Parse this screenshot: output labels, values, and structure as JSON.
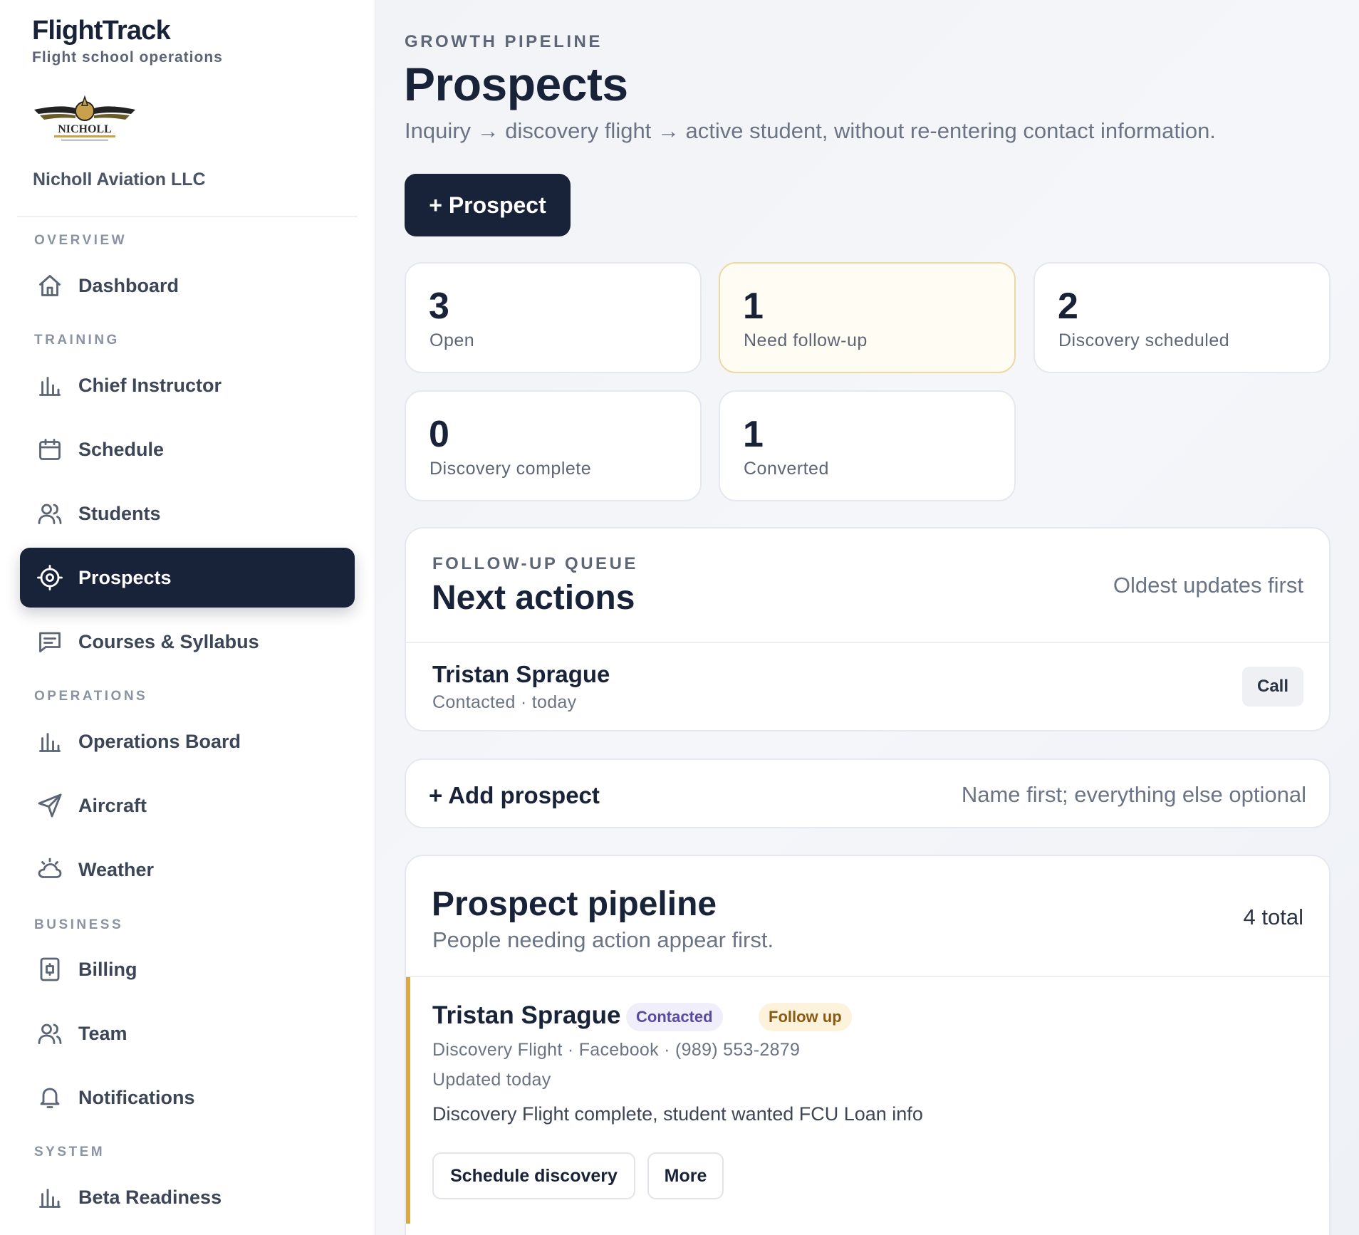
{
  "brand": {
    "name": "FlightTrack",
    "tagline": "Flight school operations",
    "org_name": "Nicholl Aviation LLC",
    "logo_text": "NICHOLL"
  },
  "sidebar": {
    "sections": {
      "overview": "OVERVIEW",
      "training": "TRAINING",
      "operations": "OPERATIONS",
      "business": "BUSINESS",
      "system": "SYSTEM"
    },
    "items": {
      "dashboard": "Dashboard",
      "chief_instructor": "Chief Instructor",
      "schedule": "Schedule",
      "students": "Students",
      "prospects": "Prospects",
      "courses": "Courses & Syllabus",
      "operations_board": "Operations Board",
      "aircraft": "Aircraft",
      "weather": "Weather",
      "billing": "Billing",
      "team": "Team",
      "notifications": "Notifications",
      "beta_readiness": "Beta Readiness"
    },
    "active": "prospects"
  },
  "header": {
    "eyebrow": "GROWTH PIPELINE",
    "title": "Prospects",
    "subtitle": "Inquiry → discovery flight → active student, without re-entering contact information.",
    "add_button": "+ Prospect"
  },
  "stats": [
    {
      "value": "3",
      "label": "Open"
    },
    {
      "value": "1",
      "label": "Need follow-up"
    },
    {
      "value": "2",
      "label": "Discovery scheduled"
    },
    {
      "value": "0",
      "label": "Discovery complete"
    },
    {
      "value": "1",
      "label": "Converted"
    }
  ],
  "queue": {
    "eyebrow": "FOLLOW-UP QUEUE",
    "title": "Next actions",
    "hint": "Oldest updates first",
    "item": {
      "name": "Tristan Sprague",
      "meta": "Contacted · today",
      "action": "Call"
    }
  },
  "add_prospect": {
    "label": "+ Add prospect",
    "hint": "Name first; everything else optional"
  },
  "pipeline": {
    "title": "Prospect pipeline",
    "subtitle": "People needing action appear first.",
    "count": "4 total",
    "row": {
      "name": "Tristan Sprague",
      "status_badge": "Contacted",
      "flag_badge": "Follow up",
      "meta": "Discovery Flight · Facebook · (989) 553-2879",
      "updated": "Updated today",
      "note": "Discovery Flight complete, student wanted FCU Loan info",
      "primary_action": "Schedule discovery",
      "secondary_action": "More"
    }
  },
  "colors": {
    "navy": "#182238",
    "accent_gold": "#d8a94a",
    "follow_bg": "#fdf3dc",
    "contacted_bg": "#f0eefb"
  }
}
